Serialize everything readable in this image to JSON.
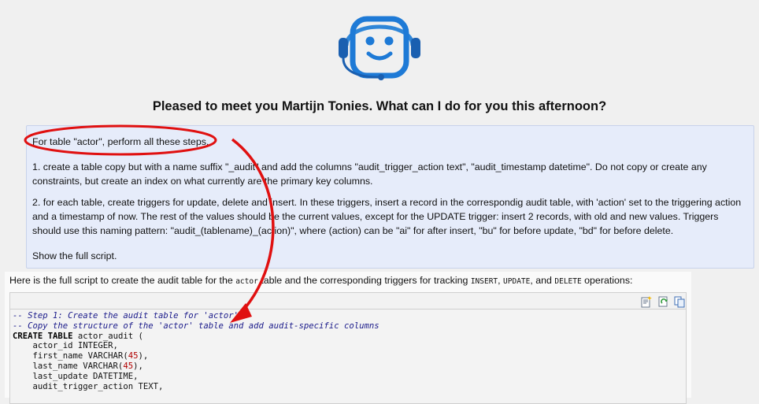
{
  "greeting": "Pleased to meet you Martijn Tonies. What can I do for you this afternoon?",
  "user_message": {
    "paragraphs": [
      "For table \"actor\", perform all these steps.",
      "1. create a table copy but with a name suffix \"_audit\" and add the columns \"audit_trigger_action text\", \"audit_timestamp datetime\". Do not copy or create any constraints, but create an index on what currently are the primary key columns.",
      "2. for each table, create triggers for update, delete and insert. In these triggers, insert a record in the correspondig audit table, with 'action' set to the triggering action and a timestamp of now. The rest of the values should be the current values, except for the UPDATE trigger: insert 2 records, with old and new values. Triggers should use this naming pattern: \"audit_(tablename)_(action)\", where (action) can be \"ai\" for after insert, \"bu\" for before update, \"bd\" for before delete.",
      "Show the full script."
    ]
  },
  "assistant": {
    "intro_parts": [
      "Here is the full script to create the audit table for the ",
      "actor",
      " table and the corresponding triggers for tracking ",
      "INSERT",
      ", ",
      "UPDATE",
      ", and ",
      "DELETE",
      " operations:"
    ],
    "toolbar_icons": [
      "insert-code-icon",
      "refresh-code-icon",
      "copy-icon"
    ],
    "code_lines": [
      [
        {
          "t": "-- Step 1: Create the audit table for 'actor'",
          "c": "comment"
        }
      ],
      [
        {
          "t": "-- Copy the structure of the 'actor' table and add audit-specific columns",
          "c": "comment"
        }
      ],
      [
        {
          "t": "CREATE TABLE",
          "c": "kw"
        },
        {
          "t": " actor_audit (",
          "c": ""
        }
      ],
      [
        {
          "t": "    actor_id INTEGER,",
          "c": ""
        }
      ],
      [
        {
          "t": "    first_name VARCHAR(",
          "c": ""
        },
        {
          "t": "45",
          "c": "num"
        },
        {
          "t": "),",
          "c": ""
        }
      ],
      [
        {
          "t": "    last_name VARCHAR(",
          "c": ""
        },
        {
          "t": "45",
          "c": "num"
        },
        {
          "t": "),",
          "c": ""
        }
      ],
      [
        {
          "t": "    last_update DATETIME,",
          "c": ""
        }
      ],
      [
        {
          "t": "    audit_trigger_action TEXT,",
          "c": ""
        }
      ]
    ]
  },
  "colors": {
    "annotation_red": "#e01010",
    "logo_blue": "#1e7ad6",
    "logo_dark": "#1a5fb0",
    "user_bubble": "#e6ecfa"
  }
}
